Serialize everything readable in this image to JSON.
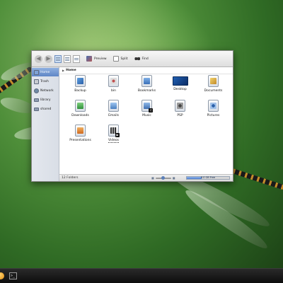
{
  "toolbar": {
    "preview_label": "Preview",
    "split_label": "Split",
    "find_label": "Find"
  },
  "sidebar": {
    "items": [
      {
        "label": "Home",
        "selected": true,
        "icon": "home-icon"
      },
      {
        "label": "Trash",
        "selected": false,
        "icon": "trash-icon"
      },
      {
        "label": "Network",
        "selected": false,
        "icon": "network-icon"
      },
      {
        "label": "library",
        "selected": false,
        "icon": "drive-icon"
      },
      {
        "label": "shared",
        "selected": false,
        "icon": "drive-icon"
      }
    ]
  },
  "breadcrumb": {
    "current": "Home"
  },
  "files": [
    {
      "label": "Backup",
      "icon": "backup-folder-icon"
    },
    {
      "label": "bin",
      "icon": "bin-folder-icon"
    },
    {
      "label": "Bookmarks",
      "icon": "bookmarks-folder-icon"
    },
    {
      "label": "Desktop",
      "icon": "desktop-folder-icon"
    },
    {
      "label": "Documents",
      "icon": "documents-folder-icon"
    },
    {
      "label": "Downloads",
      "icon": "downloads-folder-icon"
    },
    {
      "label": "Emails",
      "icon": "emails-folder-icon"
    },
    {
      "label": "Music",
      "icon": "music-folder-icon"
    },
    {
      "label": "PSP",
      "icon": "psp-folder-icon"
    },
    {
      "label": "Pictures",
      "icon": "pictures-folder-icon"
    },
    {
      "label": "Presentations",
      "icon": "presentations-folder-icon"
    },
    {
      "label": "Videos",
      "icon": "videos-folder-icon"
    }
  ],
  "status": {
    "folder_count": "12 Folders",
    "free_space": "8.0 GB Free",
    "free_fraction": 0.35,
    "zoom_fraction": 0.45
  },
  "colors": {
    "accent": "#5f86c6",
    "freebar": "#4f7fd0"
  }
}
